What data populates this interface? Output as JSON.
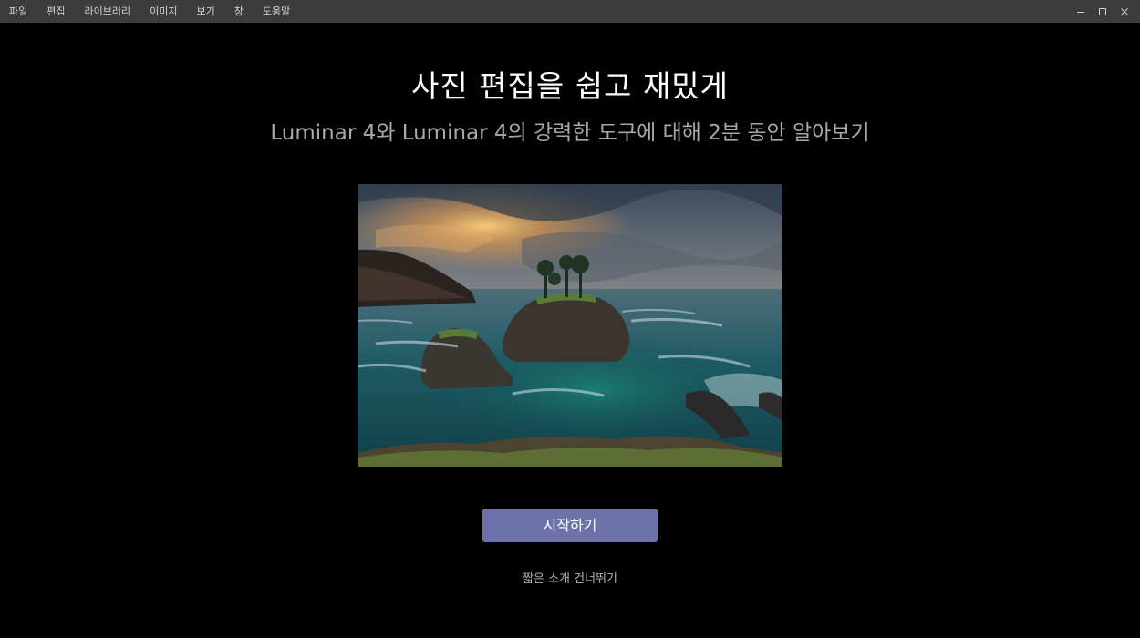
{
  "menubar": {
    "items": [
      {
        "label": "파일"
      },
      {
        "label": "편집"
      },
      {
        "label": "라이브러리"
      },
      {
        "label": "이미지"
      },
      {
        "label": "보기"
      },
      {
        "label": "창"
      },
      {
        "label": "도움말"
      }
    ]
  },
  "window_controls": {
    "minimize_icon": "minimize-icon",
    "maximize_icon": "maximize-icon",
    "close_icon": "close-icon"
  },
  "welcome": {
    "title": "사진 편집을 쉽고 재밌게",
    "subtitle": "Luminar 4와 Luminar 4의 강력한 도구에 대해 2분 동안 알아보기",
    "start_button_label": "시작하기",
    "skip_link_label": "짧은 소개 건너뛰기"
  },
  "colors": {
    "menubar_bg": "#3c3c3c",
    "page_bg": "#000000",
    "accent_button": "#6e72ab"
  }
}
